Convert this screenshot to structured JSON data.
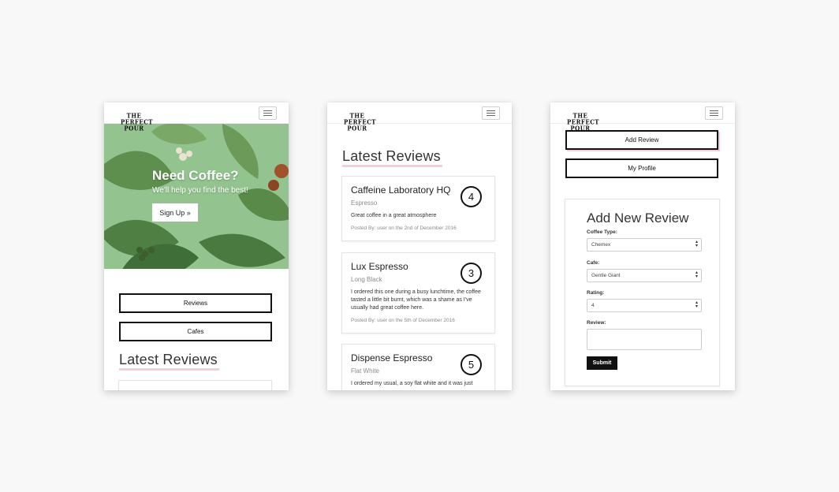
{
  "logo": {
    "lines": [
      "THE",
      "PERFECT",
      "POUR"
    ]
  },
  "phone1": {
    "hero": {
      "title": "Need Coffee?",
      "subtitle": "We'll help you find the best!",
      "cta": "Sign Up »"
    },
    "buttons": [
      "Reviews",
      "Cafes"
    ],
    "section_title": "Latest Reviews"
  },
  "phone2": {
    "section_title": "Latest Reviews",
    "reviews": [
      {
        "cafe": "Caffeine Laboratory HQ",
        "coffee": "Espresso",
        "rating": "4",
        "text": "Great coffee in a great atmosphere",
        "meta": "Posted By: user on the 2nd of December 2016"
      },
      {
        "cafe": "Lux Espresso",
        "coffee": "Long Black",
        "rating": "3",
        "text": "I ordered this one during a busy lunchtime, the coffee tasted a little bit burnt, which was a shame as I've usually had great coffee here.",
        "meta": "Posted By: user on the 5th of December 2016"
      },
      {
        "cafe": "Dispense Espresso",
        "coffee": "Flat White",
        "rating": "5",
        "text": "I ordered my usual, a soy flat white and it was just"
      }
    ]
  },
  "phone3": {
    "buttons": [
      "Add Review",
      "My Profile"
    ],
    "form": {
      "title": "Add New Review",
      "coffee_label": "Coffee Type:",
      "coffee_value": "Chemex",
      "cafe_label": "Cafe:",
      "cafe_value": "Gentle Giant",
      "rating_label": "Rating:",
      "rating_value": "4",
      "review_label": "Review:",
      "submit": "Submit"
    }
  },
  "colors": {
    "background": "#f8f8f8",
    "hero_green": "#93c48f",
    "accent_underline": "#f5cdd6",
    "ink": "#111111"
  }
}
